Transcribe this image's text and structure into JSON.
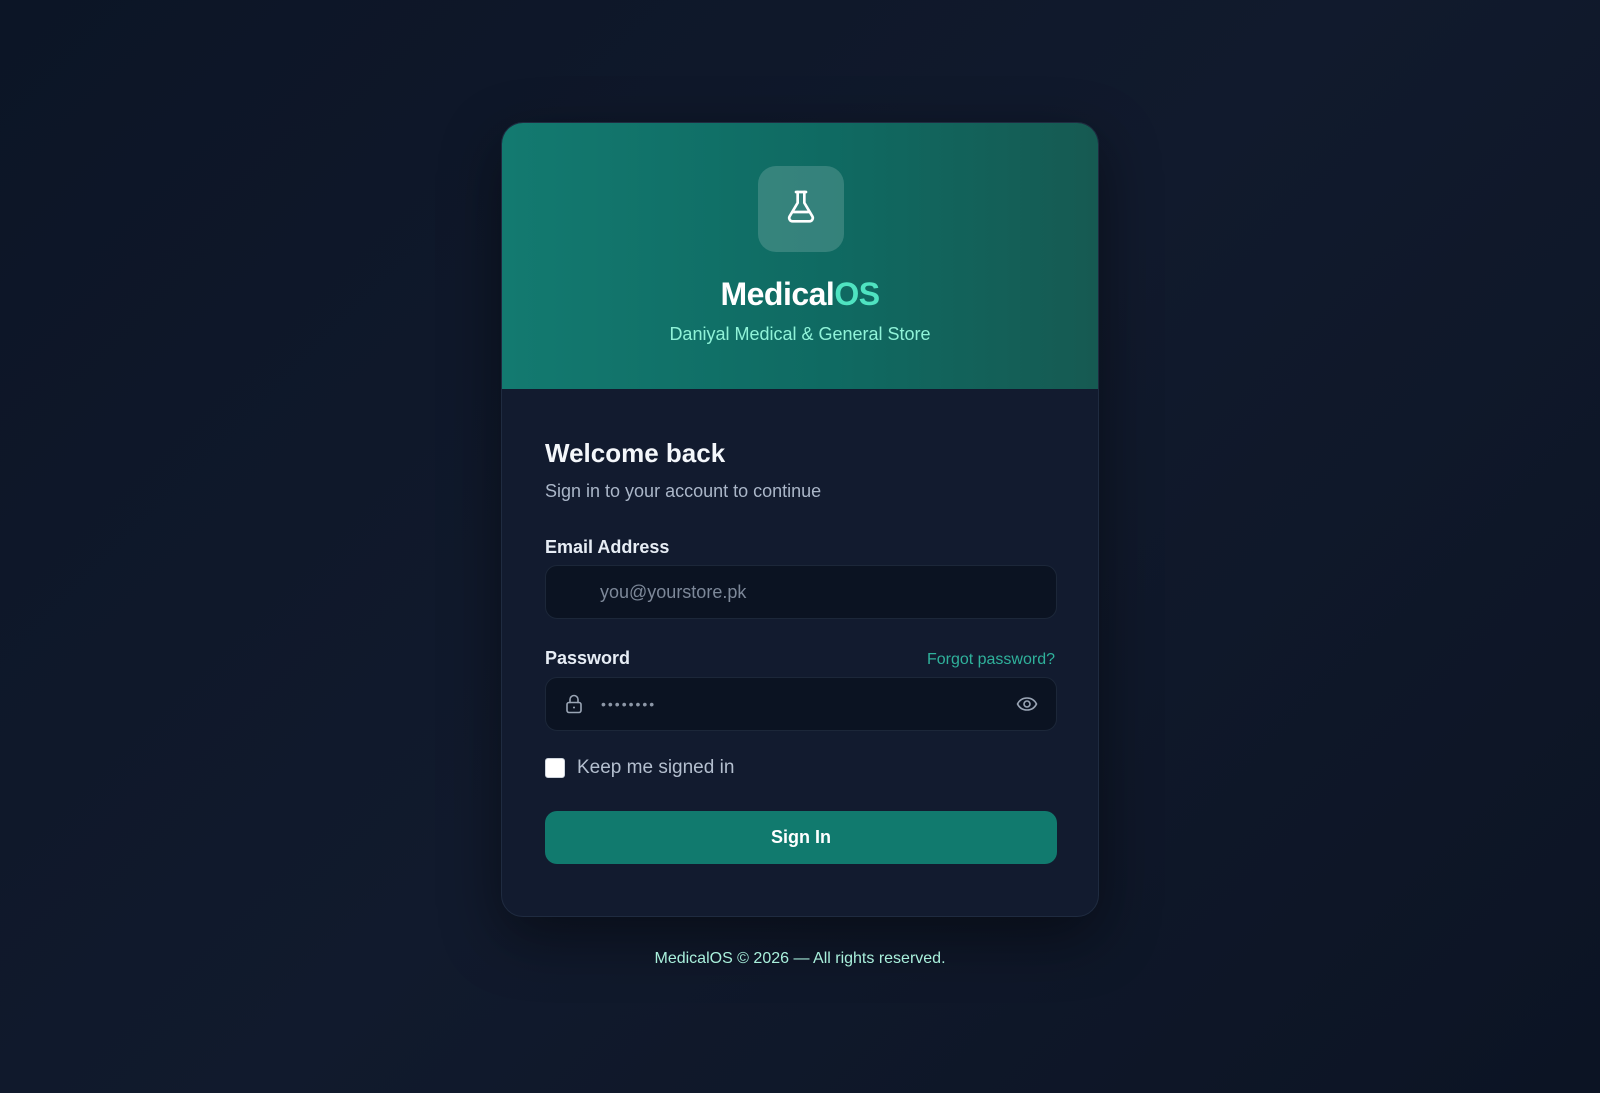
{
  "brand": {
    "name_primary": "Medical",
    "name_accent": "OS",
    "store": "Daniyal Medical & General Store",
    "logo_icon": "flask-icon"
  },
  "login": {
    "heading": "Welcome back",
    "subheading": "Sign in to your account to continue",
    "email_label": "Email Address",
    "email_placeholder": "you@yourstore.pk",
    "email_value": "",
    "password_label": "Password",
    "password_mask": "••••••••",
    "forgot_label": "Forgot password?",
    "remember_label": "Keep me signed in",
    "remember_checked": false,
    "submit_label": "Sign In"
  },
  "footer": {
    "text": "MedicalOS © 2026 — All rights reserved."
  },
  "colors": {
    "accent": "#4fe3c1",
    "primary_button": "#117a6e",
    "link": "#2fb19b",
    "header_gradient_start": "#137a70"
  }
}
